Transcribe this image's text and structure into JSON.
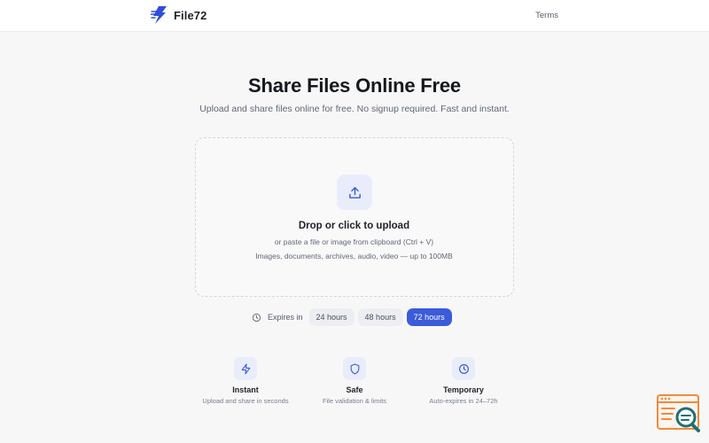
{
  "header": {
    "brand_name": "File72",
    "logo_icon": "lightning-bolt-icon",
    "terms_label": "Terms"
  },
  "hero": {
    "title": "Share Files Online Free",
    "subtitle": "Upload and share files online for free. No signup required. Fast and instant."
  },
  "dropzone": {
    "icon": "upload-icon",
    "title": "Drop or click to upload",
    "paste_hint": "or paste a file or image from clipboard (Ctrl + V)",
    "accepted_types": "Images, documents, archives, audio, video — up to 100MB"
  },
  "expiry": {
    "icon": "clock-icon",
    "label": "Expires in",
    "options": [
      {
        "label": "24 hours",
        "selected": false
      },
      {
        "label": "48 hours",
        "selected": false
      },
      {
        "label": "72 hours",
        "selected": true
      }
    ]
  },
  "features": [
    {
      "icon": "lightning-icon",
      "title": "Instant",
      "description": "Upload and share in seconds"
    },
    {
      "icon": "shield-icon",
      "title": "Safe",
      "description": "File validation & limits"
    },
    {
      "icon": "clock-icon",
      "title": "Temporary",
      "description": "Auto-expires in 24–72h"
    }
  ],
  "colors": {
    "accent": "#3b5bdb",
    "icon_background": "#e9edfb",
    "page_background": "#f7f7f8"
  }
}
